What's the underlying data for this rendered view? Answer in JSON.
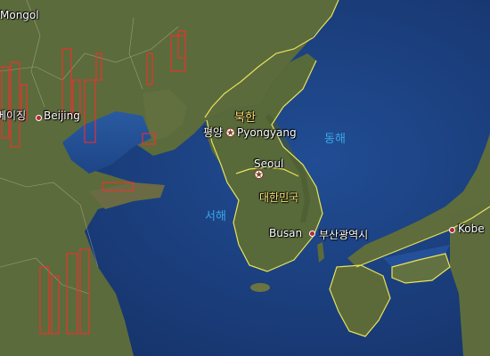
{
  "map": {
    "labels": {
      "mongolia": "Mongol",
      "beijing_ko": "베이징",
      "beijing": "Beijing",
      "north_korea": "북한",
      "pyongyang_ko": "평양",
      "pyongyang": "Pyongyang",
      "east_sea": "동해",
      "seoul": "Seoul",
      "south_korea": "대한민국",
      "west_sea": "서해",
      "busan": "Busan",
      "busan_ko": "부산광역시",
      "kobe": "Kobe"
    },
    "icons": {
      "city_marker": "circle-marker",
      "capital_marker": "star-marker"
    },
    "colors": {
      "sea": "#1b3f7a",
      "land": "#5b6a3a",
      "border": "#e8e25a",
      "highlight_boxes": "#ff2a2a"
    }
  }
}
